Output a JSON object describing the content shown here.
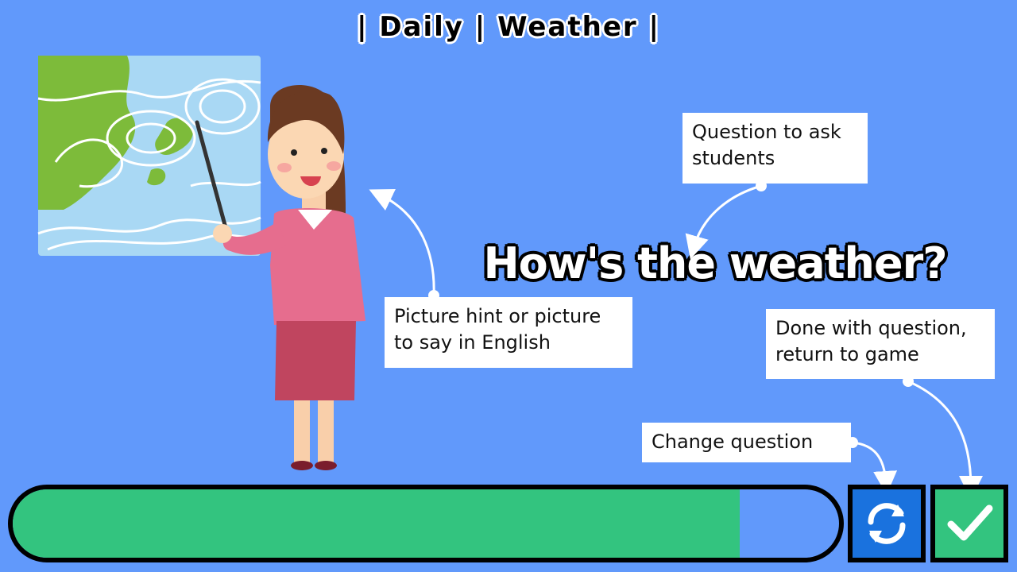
{
  "header": {
    "title": "| Daily | Weather |"
  },
  "main": {
    "question": "How's the weather?"
  },
  "callouts": {
    "question_hint": "Question to ask students",
    "picture_hint": "Picture hint or picture to say in English",
    "done_hint": "Done with question, return to game",
    "change_hint": "Change question"
  },
  "controls": {
    "progress": 0.88,
    "change_icon": "refresh-icon",
    "done_icon": "checkmark-icon"
  },
  "colors": {
    "background": "#6199fb",
    "progress_fill": "#33c47f",
    "change_button": "#1a72de",
    "done_button": "#33c47f"
  }
}
